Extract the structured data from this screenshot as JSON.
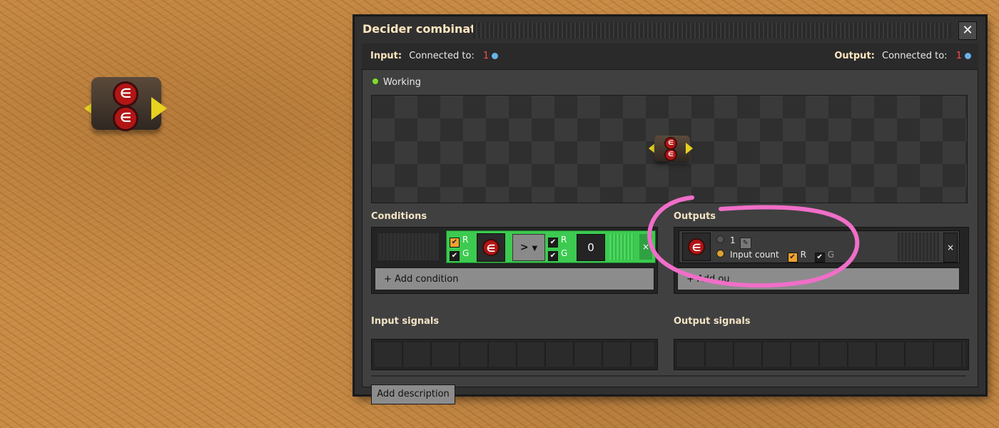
{
  "window": {
    "title": "Decider combinator",
    "close_glyph": "✕"
  },
  "connection": {
    "input_label": "Input:",
    "input_text": "Connected to:",
    "input_count": "1",
    "output_label": "Output:",
    "output_text": "Connected to:",
    "output_count": "1"
  },
  "status": {
    "text": "Working",
    "color": "#83d937"
  },
  "conditions": {
    "title": "Conditions",
    "rows": [
      {
        "left_wires": {
          "red": "R",
          "green": "G"
        },
        "signal_icon": "signal-E-icon",
        "signal_glyph": "∈",
        "operator": ">",
        "right_wires": {
          "red": "R",
          "green": "G"
        },
        "constant": "0",
        "remove_glyph": "×"
      }
    ],
    "add_label": "+ Add condition"
  },
  "outputs": {
    "title": "Outputs",
    "rows": [
      {
        "signal_icon": "signal-E-icon",
        "signal_glyph": "∈",
        "constant_value": "1",
        "input_count_label": "Input count",
        "red_label": "R",
        "green_label": "G",
        "remove_glyph": "×"
      }
    ],
    "add_label": "+ Add ou"
  },
  "input_signals": {
    "title": "Input signals"
  },
  "output_signals": {
    "title": "Output signals"
  },
  "description": {
    "button_label": "Add description"
  },
  "colors": {
    "condition_row": "#3ccb50",
    "annotation": "#f06ec8",
    "title_text": "#ffe6c0"
  }
}
